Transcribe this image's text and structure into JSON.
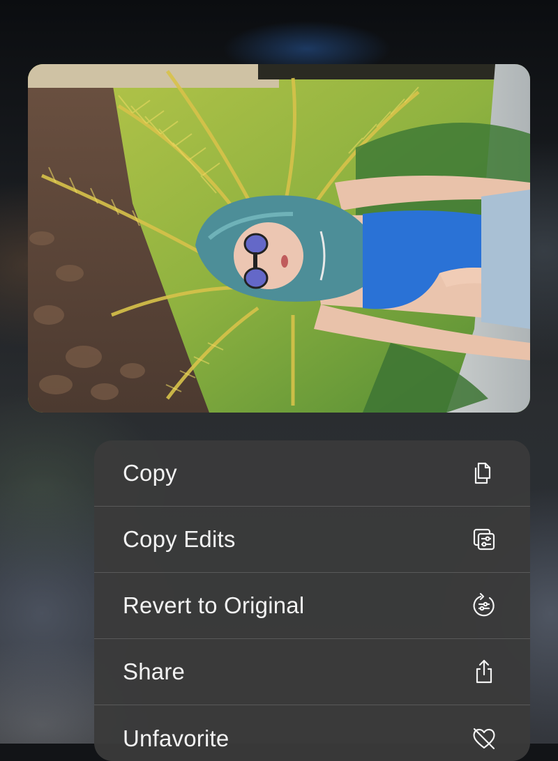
{
  "photo": {
    "subject": "photo"
  },
  "context_menu": {
    "items": [
      {
        "label": "Copy",
        "icon": "copy-icon"
      },
      {
        "label": "Copy Edits",
        "icon": "copy-edits-icon"
      },
      {
        "label": "Revert to Original",
        "icon": "revert-icon"
      },
      {
        "label": "Share",
        "icon": "share-icon"
      },
      {
        "label": "Unfavorite",
        "icon": "unfavorite-heart-icon"
      }
    ]
  }
}
